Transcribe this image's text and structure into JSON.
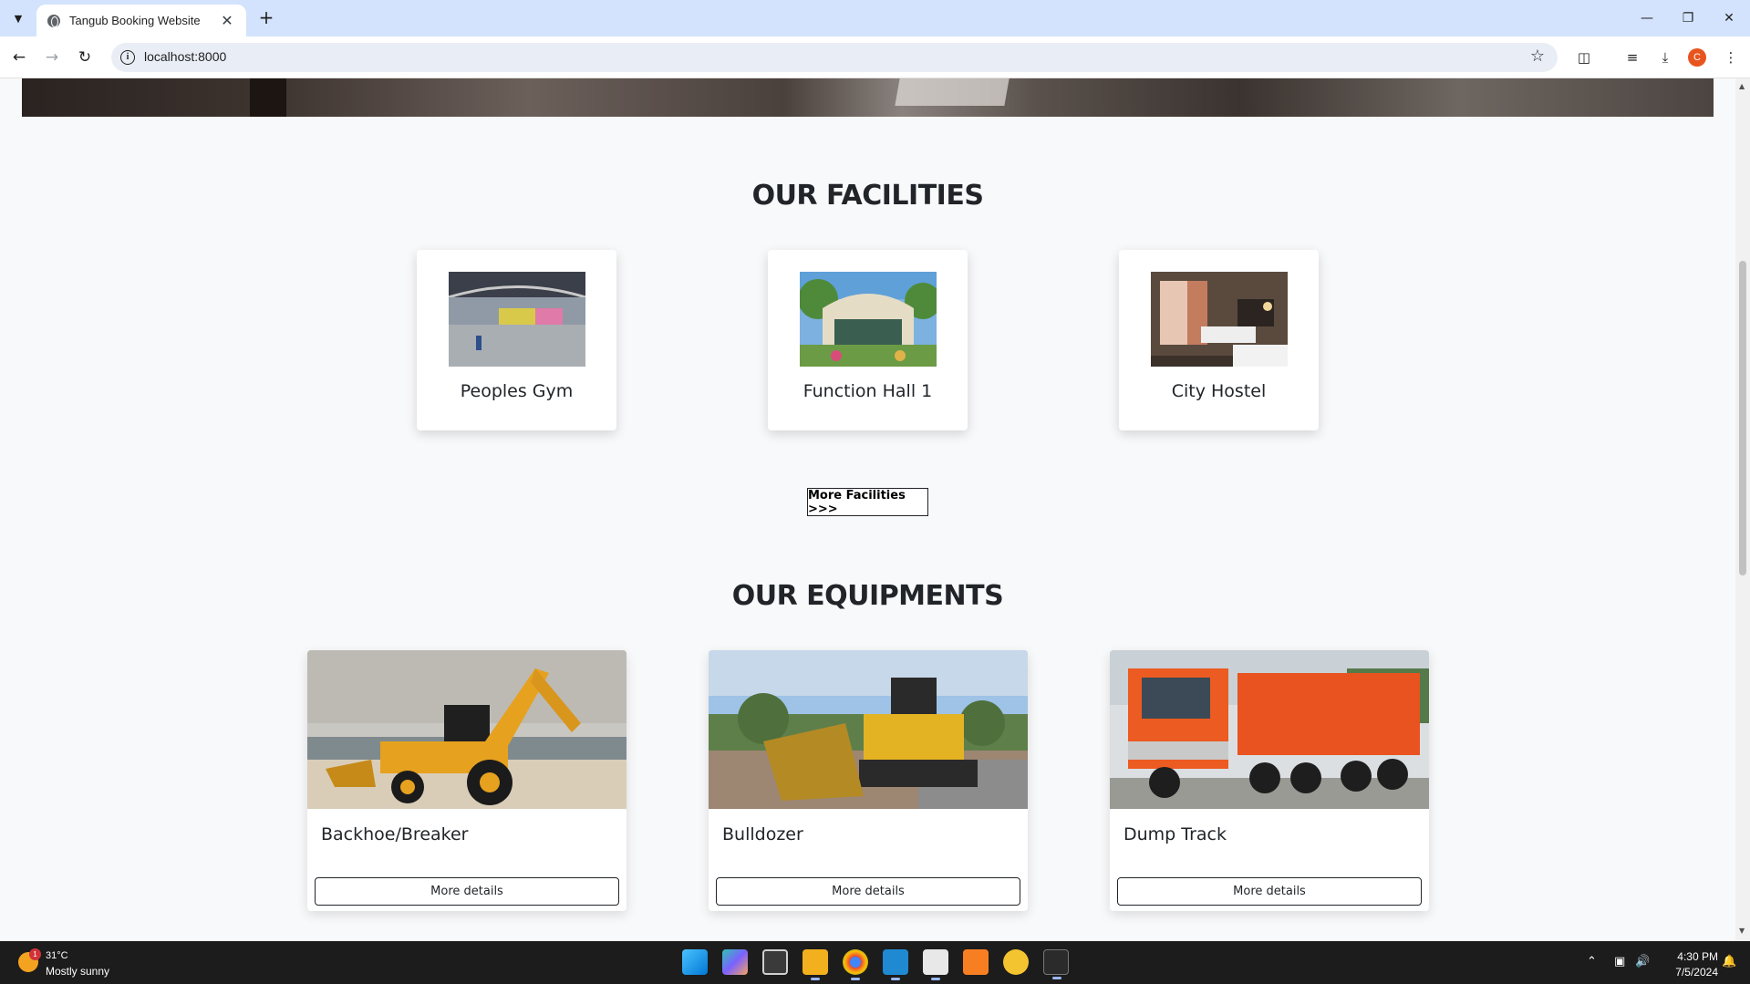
{
  "browser": {
    "tab_title": "Tangub Booking Website",
    "url": "localhost:8000",
    "profile_initial": "C"
  },
  "page": {
    "facilities_title": "OUR FACILITIES",
    "facilities": [
      {
        "name": "Peoples Gym"
      },
      {
        "name": "Function Hall 1"
      },
      {
        "name": "City Hostel"
      }
    ],
    "more_facilities_label": "More Facilities >>>",
    "equipments_title": "OUR EQUIPMENTS",
    "equipments": [
      {
        "name": "Backhoe/Breaker",
        "button": "More details"
      },
      {
        "name": "Bulldozer",
        "button": "More details"
      },
      {
        "name": "Dump Track",
        "button": "More details"
      }
    ]
  },
  "taskbar": {
    "weather_badge": "1",
    "temperature": "31°C",
    "weather": "Mostly sunny",
    "time": "4:30 PM",
    "date": "7/5/2024"
  },
  "colors": {
    "tabbar": "#d3e3fd",
    "page_bg": "#f8f9fa",
    "profile": "#e8541e",
    "taskbar": "#1c1c1c"
  }
}
